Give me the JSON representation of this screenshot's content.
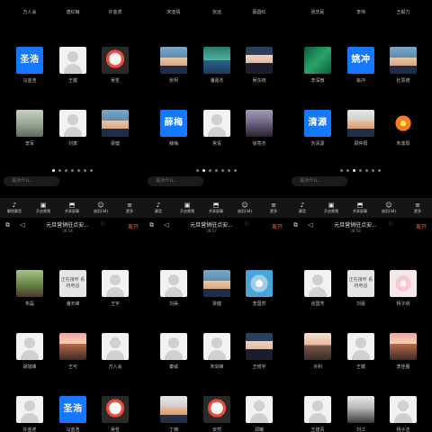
{
  "screens": [
    {
      "top_names": [
        "万人会",
        "唐红梅",
        "许金虎"
      ],
      "rows": [
        [
          {
            "name": "马蓝浩",
            "type": "text",
            "text": "圣浩"
          },
          {
            "name": "王键",
            "type": "blank"
          },
          {
            "name": "吴哲",
            "type": "photo-mascot"
          }
        ],
        [
          {
            "name": "李军",
            "type": "photo-tree"
          },
          {
            "name": "刘寅",
            "type": "blank"
          },
          {
            "name": "梁健",
            "type": "photo-man"
          }
        ]
      ],
      "chat_placeholder": "说点什么...",
      "dots_total": 7,
      "dots_active": 0,
      "toolbar": [
        "解除静音",
        "开启视频",
        "共享屏幕",
        "成员(44)",
        "更多"
      ]
    },
    {
      "top_names": [
        "宋亚倩",
        "张远",
        "蔡圆红"
      ],
      "rows": [
        [
          {
            "name": "张柯",
            "type": "photo-man"
          },
          {
            "name": "潘嘉杰",
            "type": "photo-lake"
          },
          {
            "name": "吴东晓",
            "type": "photo-woman"
          }
        ],
        [
          {
            "name": "薛梅",
            "type": "text",
            "text": "薛梅"
          },
          {
            "name": "常青",
            "type": "blank"
          },
          {
            "name": "徐亮杰",
            "type": "photo-dark"
          }
        ]
      ],
      "chat_placeholder": "说点什么...",
      "dots_total": 7,
      "dots_active": 1,
      "toolbar": [
        "静音",
        "开启视频",
        "共享屏幕",
        "成员(44)",
        "更多"
      ]
    },
    {
      "top_names": [
        "张庆民",
        "李伟",
        "王毅力"
      ],
      "rows": [
        [
          {
            "name": "李深微",
            "type": "photo-green"
          },
          {
            "name": "姚冲",
            "type": "text",
            "text": "姚冲"
          },
          {
            "name": "杜思德",
            "type": "photo-man"
          }
        ],
        [
          {
            "name": "刘清源",
            "type": "text",
            "text": "清源"
          },
          {
            "name": "顾仲阳",
            "type": "photo-man2"
          },
          {
            "name": "朱逢阳",
            "type": "photo-sun"
          }
        ]
      ],
      "chat_placeholder": "说点什么...",
      "dots_total": 7,
      "dots_active": 2,
      "toolbar": [
        "静音",
        "开启视频",
        "共享屏幕",
        "成员(44)",
        "更多"
      ]
    }
  ],
  "meetings": [
    {
      "title": "元旦营销驻点安...",
      "time": "26:54",
      "leave": "离开",
      "rows": [
        [
          {
            "name": "朱磊",
            "type": "photo-field"
          },
          {
            "name": "潘天峰",
            "type": "status",
            "text": "正在接听 系统电话"
          },
          {
            "name": "王宇",
            "type": "blank"
          }
        ],
        [
          {
            "name": "胡旭峰",
            "type": "blank"
          },
          {
            "name": "王可",
            "type": "photo-family"
          },
          {
            "name": "万人会",
            "type": "blank"
          }
        ],
        [
          {
            "name": "许金虎",
            "type": "blank"
          },
          {
            "name": "马蓝浩",
            "type": "text",
            "text": "圣浩"
          },
          {
            "name": "吴哲",
            "type": "photo-mascot"
          }
        ]
      ]
    },
    {
      "title": "元旦营销驻点安...",
      "time": "26:57",
      "leave": "离开",
      "rows": [
        [
          {
            "name": "刘昊",
            "type": "blank"
          },
          {
            "name": "梁健",
            "type": "photo-man"
          },
          {
            "name": "李国然",
            "type": "photo-blue"
          }
        ],
        [
          {
            "name": "秦威",
            "type": "blank"
          },
          {
            "name": "朱剑峰",
            "type": "blank"
          },
          {
            "name": "王晓宇",
            "type": "photo-woman"
          }
        ],
        [
          {
            "name": "丁楠",
            "type": "photo-man2"
          },
          {
            "name": "安然",
            "type": "photo-mascot"
          },
          {
            "name": "郑曦",
            "type": "blank"
          }
        ]
      ]
    },
    {
      "title": "元旦营销驻点安...",
      "time": "26:58",
      "leave": "离开",
      "rows": [
        [
          {
            "name": "张国芳",
            "type": "blank"
          },
          {
            "name": "刘豪",
            "type": "status",
            "text": "正在接听 系统电话"
          },
          {
            "name": "杨子玥",
            "type": "photo-flower"
          }
        ],
        [
          {
            "name": "许利",
            "type": "photo-girl"
          },
          {
            "name": "王键",
            "type": "blank"
          },
          {
            "name": "李佳蕾",
            "type": "photo-family"
          }
        ],
        [
          {
            "name": "王建青",
            "type": "blank"
          },
          {
            "name": "刘江",
            "type": "photo-road"
          },
          {
            "name": "杨子洁",
            "type": "blank"
          }
        ]
      ]
    }
  ]
}
